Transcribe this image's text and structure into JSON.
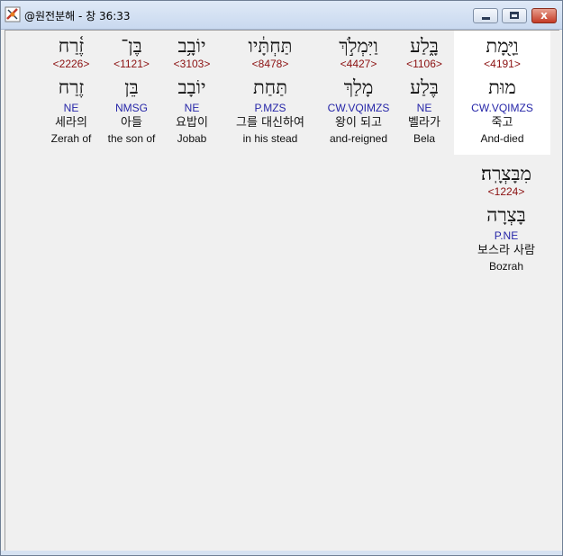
{
  "window": {
    "title": "@원전분해 - 창 36:33",
    "close_label": "x"
  },
  "words": [
    {
      "hebrew": "זֶ֫רַח",
      "strong": "<2226>",
      "root": "זֶרַח",
      "morph": "NE",
      "korean": "세라의",
      "english": "Zerah of"
    },
    {
      "hebrew": "בֶּן־",
      "strong": "<1121>",
      "root": "בֵּן",
      "morph": "NMSG",
      "korean": "아들",
      "english": "the son of"
    },
    {
      "hebrew": "יוֹבָ֥ב",
      "strong": "<3103>",
      "root": "יוֹבָב",
      "morph": "NE",
      "korean": "요밥이",
      "english": "Jobab"
    },
    {
      "hebrew": "תַּחְתָּ֔יו",
      "strong": "<8478>",
      "root": "תַּחַת",
      "morph": "P.MZS",
      "korean": "그를 대신하여",
      "english": "in his stead"
    },
    {
      "hebrew": "וַיִּמְלֹ֣ךְ",
      "strong": "<4427>",
      "root": "מָלַךְ",
      "morph": "CW.VQIMZS",
      "korean": "왕이 되고",
      "english": "and-reigned"
    },
    {
      "hebrew": "בָּ֑לַע",
      "strong": "<1106>",
      "root": "בֶּלַע",
      "morph": "NE",
      "korean": "벨라가",
      "english": "Bela"
    },
    {
      "hebrew": "וַיָּ֖מָת",
      "strong": "<4191>",
      "root": "מוּת",
      "morph": "CW.VQIMZS",
      "korean": "죽고",
      "english": "And-died"
    },
    {
      "hebrew": "מִבָּצְרָֽה׃",
      "strong": "<1224>",
      "root": "בָּצְרָה",
      "morph": "P.NE",
      "korean": "보스라 사람",
      "english": "Bozrah"
    }
  ]
}
